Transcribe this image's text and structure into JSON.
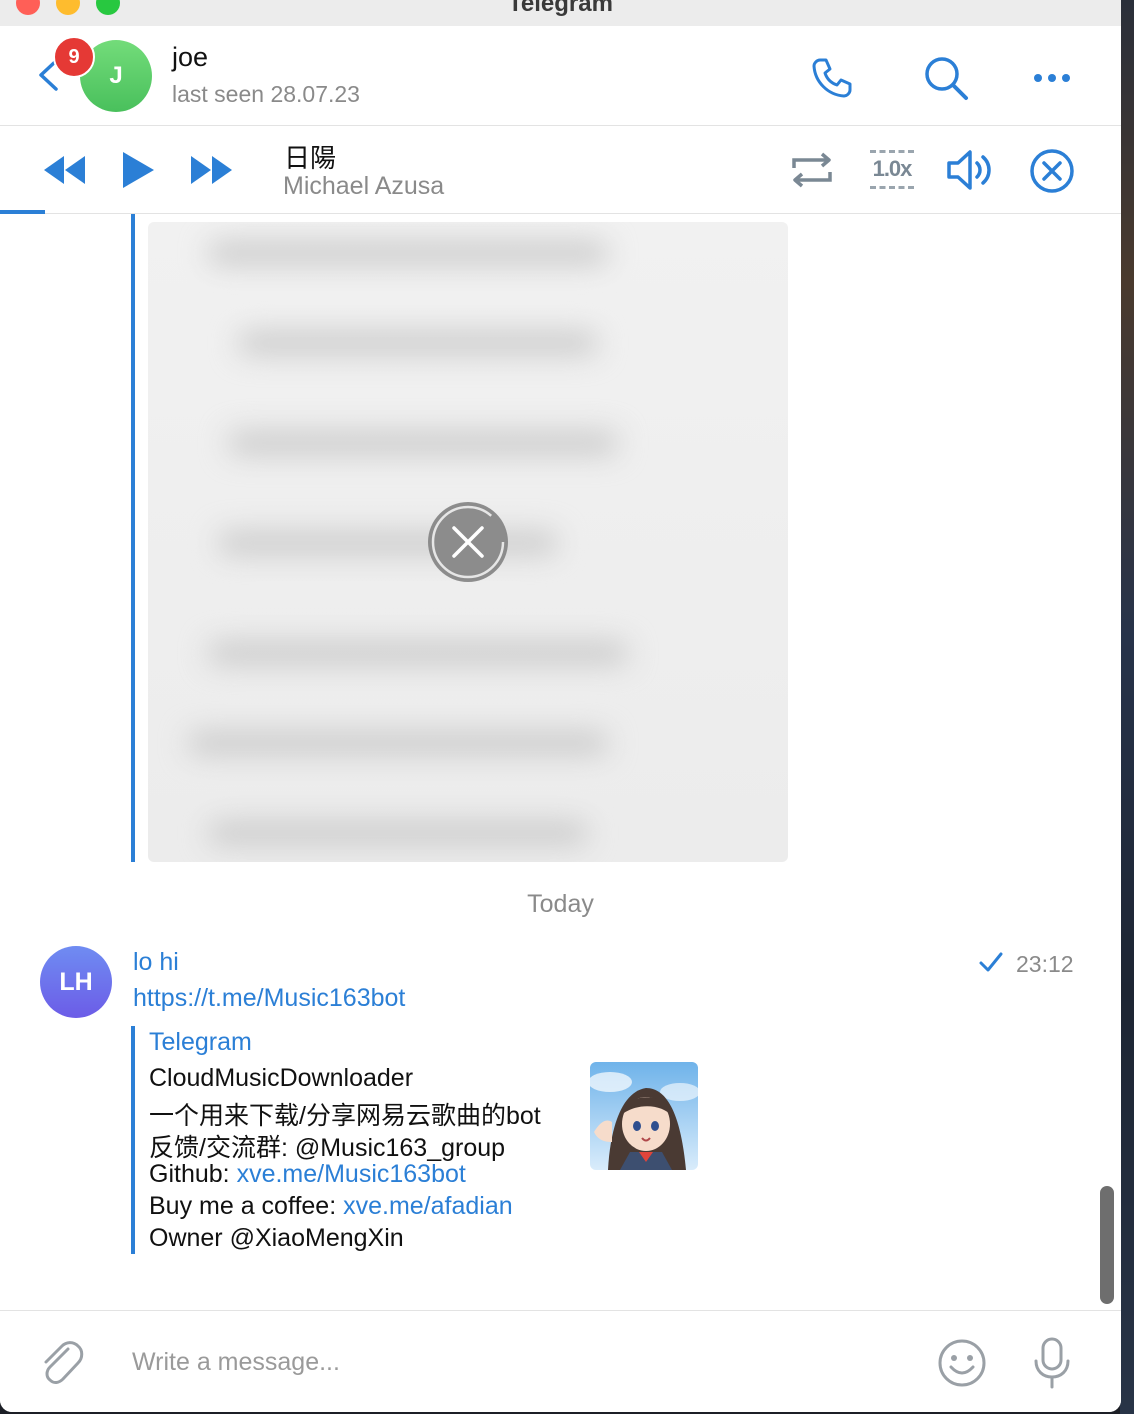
{
  "window": {
    "title": "Telegram"
  },
  "header": {
    "unread_count": "9",
    "peer_initial": "J",
    "peer_name": "joe",
    "peer_status": "last seen 28.07.23"
  },
  "player": {
    "track_title": "日陽",
    "track_artist": "Michael Azusa",
    "speed": "1.0x"
  },
  "messages": {
    "date_separator": "Today",
    "sender_initials": "LH",
    "sender_name": "lo hi",
    "time": "23:12",
    "link": "https://t.me/Music163bot",
    "preview": {
      "site_name": "Telegram",
      "title": "CloudMusicDownloader",
      "line1": "一个用来下载/分享网易云歌曲的bot",
      "line2": "反馈/交流群: @Music163_group",
      "line3_prefix": "Github: ",
      "line3_link": "xve.me/Music163bot",
      "line4_prefix": "Buy me a coffee: ",
      "line4_link": "xve.me/afadian",
      "line5": "Owner @XiaoMengXin"
    }
  },
  "composer": {
    "placeholder": "Write a message..."
  },
  "colors": {
    "accent": "#2b7fd6",
    "badge": "#e53935",
    "online_avatar": "#4cc45f",
    "sender_avatar": "#6c5ce7"
  }
}
